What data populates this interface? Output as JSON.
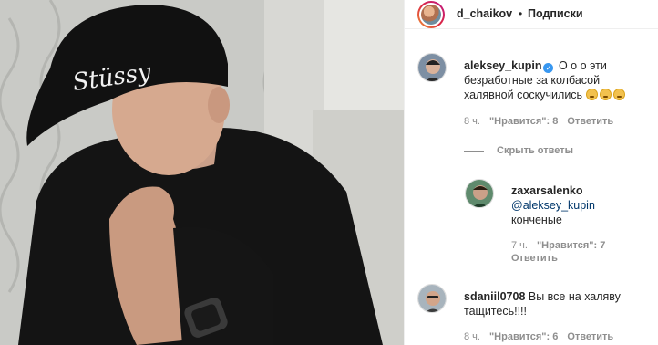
{
  "header": {
    "username": "d_chaikov",
    "separator": "•",
    "follow_label": "Подписки"
  },
  "comments": [
    {
      "username": "aleksey_kupin",
      "verified": true,
      "text": "О о о эти безработные за колбасой халявной соскучились",
      "emoji_count": 3,
      "time": "8 ч.",
      "likes": "\"Нравится\": 8",
      "reply_label": "Ответить"
    },
    {
      "username": "zaxarsalenko",
      "mention": "@aleksey_kupin",
      "text": "конченые",
      "time": "7 ч.",
      "likes": "\"Нравится\": 7",
      "reply_label": "Ответить"
    },
    {
      "username": "sdaniil0708",
      "text": "Вы все на халяву тащитесь!!!!",
      "time": "8 ч.",
      "likes": "\"Нравится\": 6",
      "reply_label": "Ответить"
    }
  ],
  "hide_replies_label": "Скрыть ответы",
  "photo": {
    "cap_text": "Stüssy"
  },
  "icons": {
    "verified": "verified-badge-icon",
    "emoji": "flushed-face-emoji-icon"
  }
}
